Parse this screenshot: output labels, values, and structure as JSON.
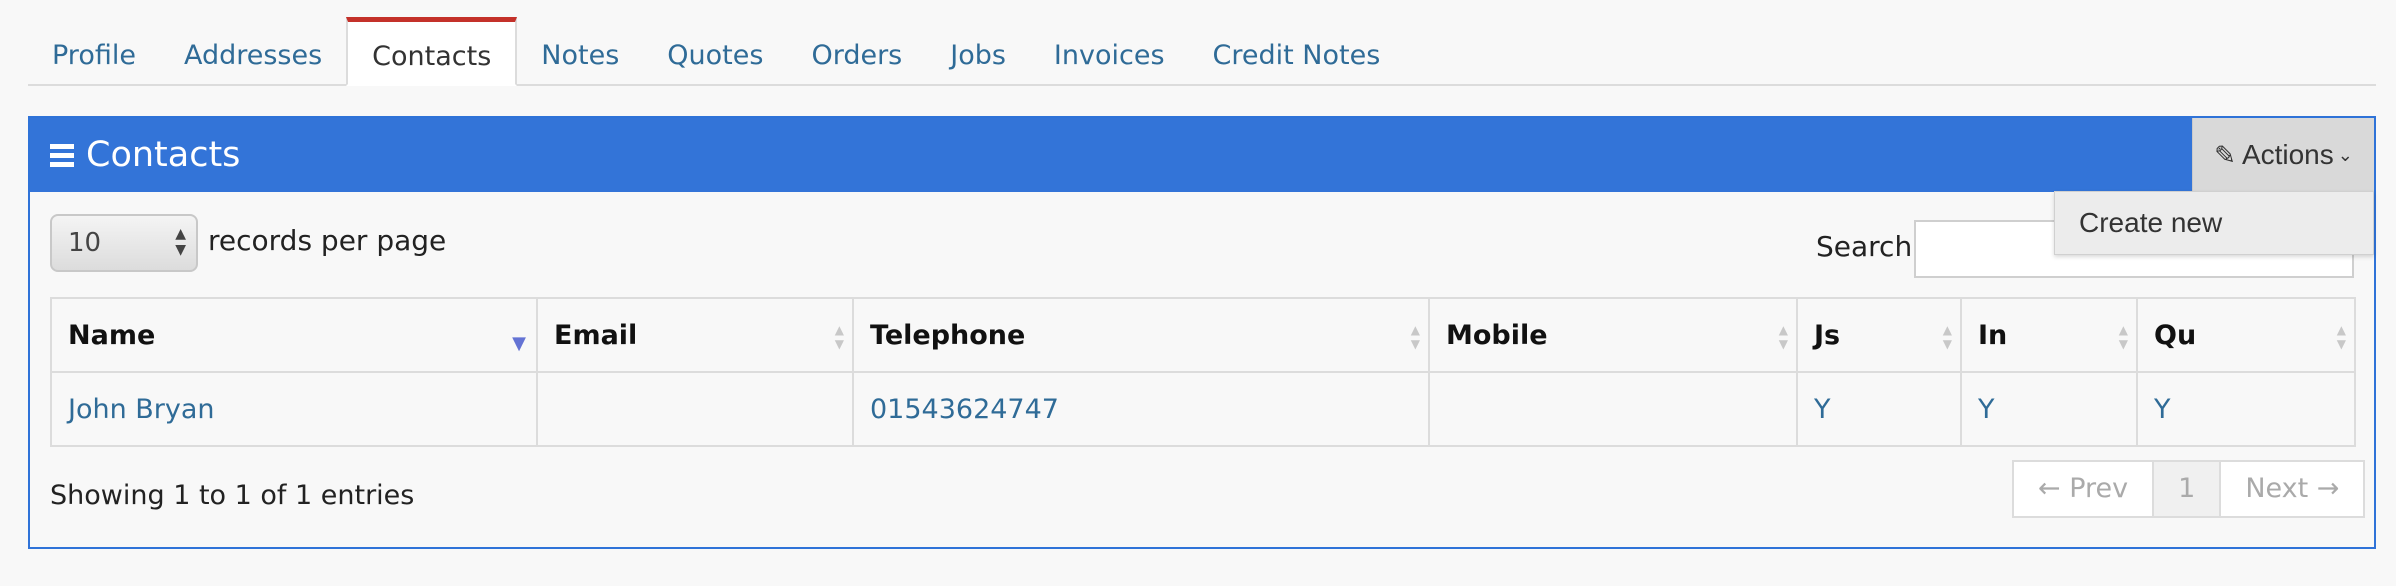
{
  "tabs": [
    "Profile",
    "Addresses",
    "Contacts",
    "Notes",
    "Quotes",
    "Orders",
    "Jobs",
    "Invoices",
    "Credit Notes"
  ],
  "active_tab": "Contacts",
  "panel": {
    "title": "Contacts",
    "actions_label": "Actions",
    "menu": [
      "Create new"
    ]
  },
  "records": {
    "value": "10",
    "label": "records per page"
  },
  "search": {
    "label": "Search:",
    "value": ""
  },
  "table": {
    "columns": [
      "Name",
      "Email",
      "Telephone",
      "Mobile",
      "Js",
      "In",
      "Qu"
    ],
    "rows": [
      [
        "John Bryan",
        "",
        "01543624747",
        "",
        "Y",
        "Y",
        "Y"
      ]
    ]
  },
  "info": "Showing 1 to 1 of 1 entries",
  "pagination": {
    "prev": "← Prev",
    "page": "1",
    "next": "Next →"
  },
  "colors": {
    "header": "#3374d8",
    "active_tab_border": "#c4312a",
    "link": "#2f6b97"
  }
}
